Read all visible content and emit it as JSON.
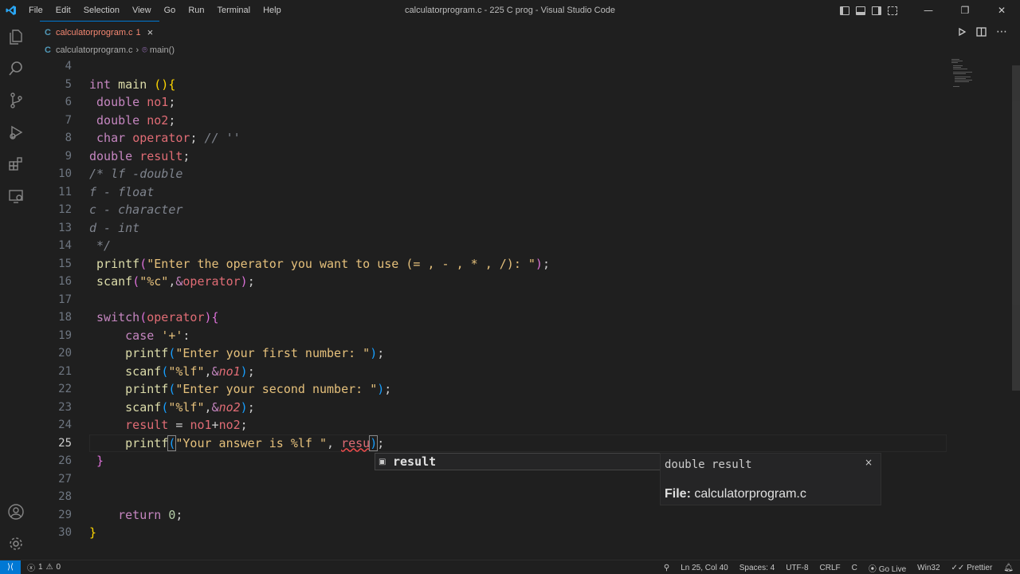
{
  "window": {
    "title": "calculatorprogram.c - 225 C prog - Visual Studio Code"
  },
  "menu": [
    "File",
    "Edit",
    "Selection",
    "View",
    "Go",
    "Run",
    "Terminal",
    "Help"
  ],
  "window_controls": {
    "minimize": "—",
    "restore": "❐",
    "close": "✕"
  },
  "tab": {
    "icon": "C",
    "filename": "calculatorprogram.c",
    "problems": "1",
    "close": "×"
  },
  "breadcrumb": {
    "icon": "C",
    "file": "calculatorprogram.c",
    "separator": "›",
    "symbol_icon": "⌾",
    "symbol": "main()"
  },
  "editor": {
    "current_line": 25,
    "line_numbers": [
      "4",
      "5",
      "6",
      "7",
      "8",
      "9",
      "10",
      "11",
      "12",
      "13",
      "14",
      "15",
      "16",
      "17",
      "18",
      "19",
      "20",
      "21",
      "22",
      "23",
      "24",
      "25",
      "26",
      "27",
      "28",
      "29",
      "30"
    ]
  },
  "suggest": {
    "icon": "▣",
    "label": "result"
  },
  "detail": {
    "signature": "double result",
    "close": "×",
    "file_label": "File:",
    "file_value": " calculatorprogram.c"
  },
  "status": {
    "remote": "⟩⟨",
    "errors": "1",
    "warnings": "0",
    "position": "Ln 25, Col 40",
    "spaces": "Spaces: 4",
    "encoding": "UTF-8",
    "eol": "CRLF",
    "language": "C",
    "go_live": "Go Live",
    "platform": "Win32",
    "prettier": "Prettier"
  },
  "colors": {
    "accent": "#0078d4",
    "background": "#1f1f1f",
    "error_tab": "#f48771"
  }
}
